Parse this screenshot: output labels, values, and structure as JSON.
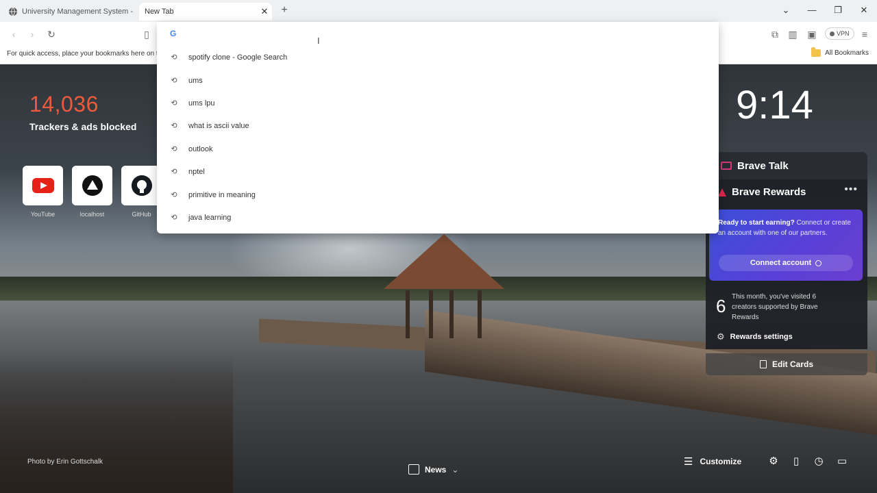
{
  "tabs": [
    {
      "title": "University Management System - St",
      "active": false
    },
    {
      "title": "New Tab",
      "active": true
    }
  ],
  "new_tab_symbol": "+",
  "bookmarks_bar": {
    "hint": "For quick access, place your bookmarks here on th",
    "all_bookmarks": "All Bookmarks"
  },
  "vpn_label": "VPN",
  "omnibox": {
    "value": "",
    "suggestions": [
      "spotify clone - Google Search",
      "ums",
      "ums lpu",
      "what is ascii value",
      "outlook",
      "nptel",
      "primitive in meaning",
      "java learning"
    ]
  },
  "stats": {
    "count": "14,036",
    "label": "Trackers & ads blocked"
  },
  "top_sites": [
    {
      "name": "YouTube",
      "icon": "youtube-icon"
    },
    {
      "name": "localhost",
      "icon": "localhost-icon"
    },
    {
      "name": "GitHub",
      "icon": "github-icon"
    }
  ],
  "clock": "9:14",
  "brave_talk": {
    "title": "Brave Talk"
  },
  "brave_rewards": {
    "title": "Brave Rewards",
    "more": "•••",
    "promo_bold": "Ready to start earning?",
    "promo_text": " Connect or create an account with one of our partners.",
    "connect_label": "Connect account",
    "visit_count": "6",
    "visit_text": "This month, you've visited 6 creators supported by Brave Rewards",
    "settings_label": "Rewards settings"
  },
  "edit_cards_label": "Edit Cards",
  "photo_credit": "Photo by Erin Gottschalk",
  "news_label": "News",
  "customize_label": "Customize",
  "colors": {
    "accent_orange": "#f05a3c",
    "rewards_gradient_start": "#3b4fd8",
    "rewards_gradient_end": "#6a3fd0"
  }
}
